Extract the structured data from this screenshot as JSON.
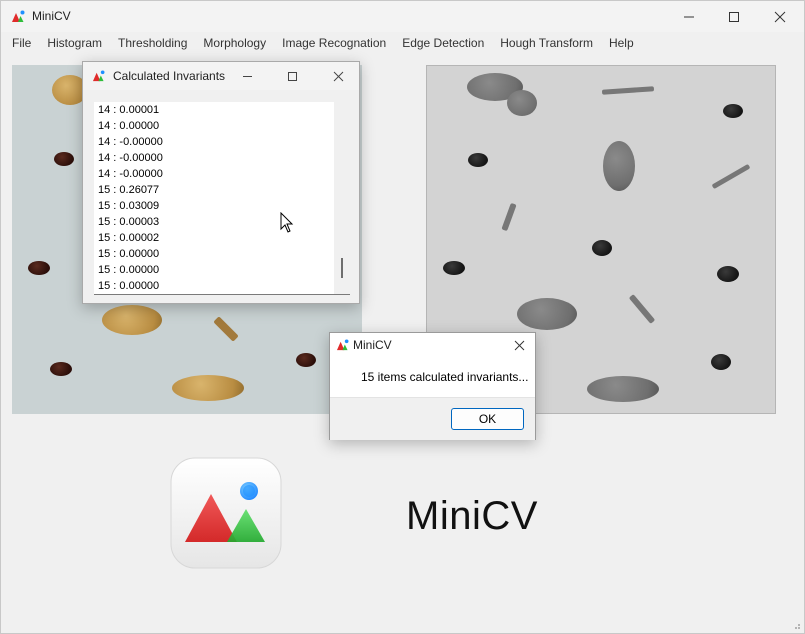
{
  "window": {
    "title": "MiniCV",
    "minimize_icon": "minimize-icon",
    "maximize_icon": "maximize-icon",
    "close_icon": "close-icon"
  },
  "menu": [
    "File",
    "Histogram",
    "Thresholding",
    "Morphology",
    "Image Recognation",
    "Edge Detection",
    "Hough Transform",
    "Help"
  ],
  "branding": {
    "app_name": "MiniCV",
    "colors": {
      "red": "#e02b2b",
      "green": "#2ebd3a",
      "blue": "#1e90ff"
    }
  },
  "invariants_dialog": {
    "title": "Calculated Invariants",
    "items": [
      "14 : 0.00001",
      "14 : 0.00000",
      "14 : -0.00000",
      "14 : -0.00000",
      "14 : -0.00000",
      "15 : 0.26077",
      "15 : 0.03009",
      "15 : 0.00003",
      "15 : 0.00002",
      "15 : 0.00000",
      "15 : 0.00000",
      "15 : 0.00000"
    ]
  },
  "message_dialog": {
    "title": "MiniCV",
    "message": "15 items calculated invariants...",
    "ok_label": "OK"
  }
}
